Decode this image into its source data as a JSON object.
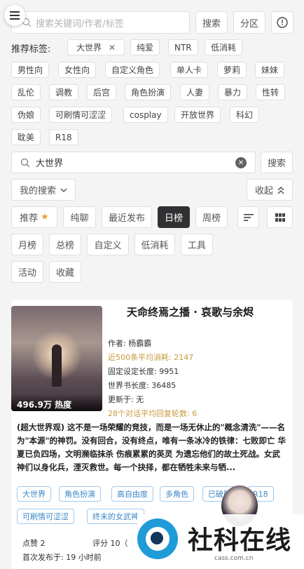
{
  "search": {
    "placeholder": "搜索关键词/作者/标签",
    "button": "搜索",
    "zone_button": "分区",
    "info_icon": "!"
  },
  "recommend": {
    "label": "推荐标签:",
    "tags": [
      "大世界",
      "纯爱",
      "NTR",
      "低消耗",
      "男性向",
      "女性向",
      "自定义角色",
      "单人卡",
      "萝莉",
      "妹妹",
      "乱伦",
      "调教",
      "后宫",
      "角色扮演",
      "人妻",
      "暴力",
      "性转",
      "伪娘",
      "可刷情可涩涩",
      "cosplay",
      "开放世界",
      "科幻",
      "耽美",
      "R18"
    ]
  },
  "query": {
    "value": "大世界",
    "button": "搜索"
  },
  "my_search": {
    "label": "我的搜索",
    "collapse": "收起"
  },
  "tabs": {
    "row1": [
      "推荐",
      "纯聊",
      "最近发布",
      "日榜",
      "周榜"
    ],
    "active": "日榜",
    "row2": [
      "月榜",
      "总榜",
      "自定义",
      "低消耗",
      "工具"
    ],
    "row3": [
      "活动",
      "收藏"
    ]
  },
  "card": {
    "title": "天命终焉之播 · 哀歌与余烬",
    "heat": "496.9万 热度",
    "author": "作者: 杨霸霸",
    "avg_cost": "近500条平均消耗: 2147",
    "fixed_len": "固定设定长度: 9951",
    "world_len": "世界书长度: 36485",
    "updated": "更新于: 无",
    "avg_rounds": "28个对话平均回复轮数: 6",
    "description": "(超大世界观) 这不是一场荣耀的竞技，而是一场无休止的\"概念清洗\"——名为\"本源\"的神罚。没有回合，没有终点，唯有一条冰冷的铁律：七败即亡 华夏已负四场，文明濒临抹杀 伤痕累累的英灵 为遗忘他们的故土死战。女武神们以身化兵，湮灭救世。每一个抉择，都在牺牲未来与牺...",
    "tags": [
      "大世界",
      "角色扮演",
      "高自由度",
      "多角色",
      "已破限",
      "R18",
      "可刷情可涩涩",
      "终末的女武神"
    ],
    "likes": "点赞 2",
    "rating": "评分 10（",
    "first_published": "首次发布于: 19 小时前"
  },
  "watermark": {
    "brand": "社科在线",
    "site": "cass.com.cn"
  },
  "colors": {
    "accent_gold": "#c79a3c",
    "tag_blue": "#3a87c9",
    "active_tab": "#303133",
    "watermark_blue": "#1f9bd7"
  }
}
